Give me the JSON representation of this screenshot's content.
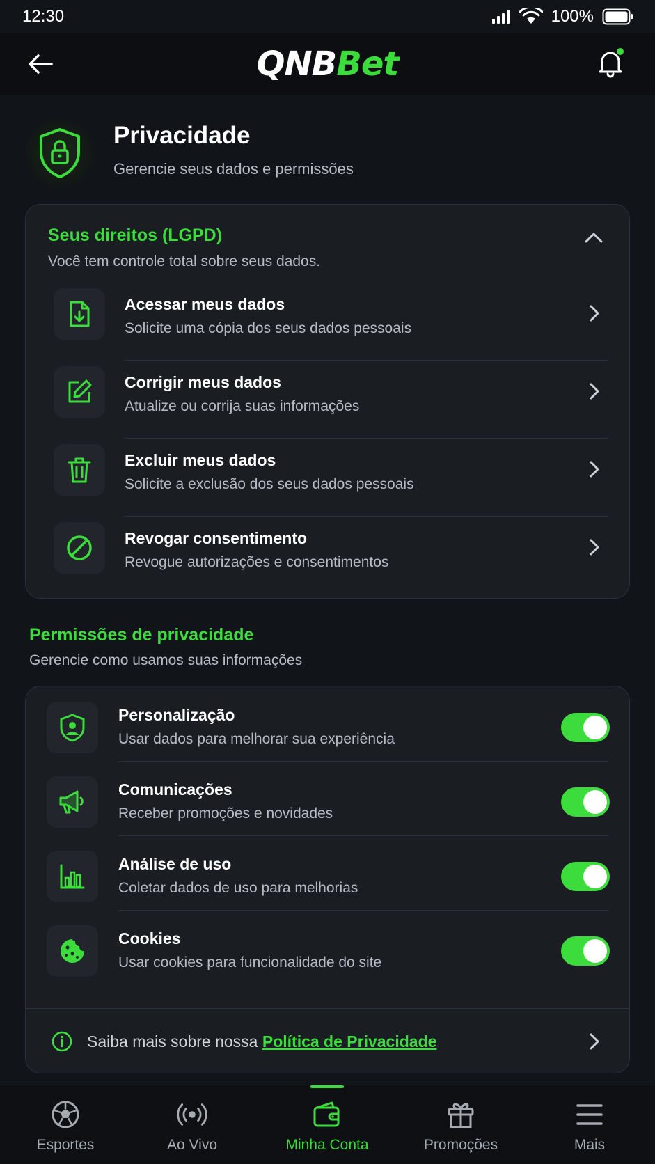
{
  "status_bar": {
    "time": "12:30",
    "battery": "100%"
  },
  "header": {
    "logo_left": "QNB",
    "logo_right": "Bet"
  },
  "page": {
    "title": "Privacidade",
    "subtitle": "Gerencie seus dados e permissões"
  },
  "rights": {
    "title": "Seus direitos (LGPD)",
    "subtitle": "Você tem controle total sobre seus dados.",
    "items": [
      {
        "title": "Acessar meus dados",
        "subtitle": "Solicite uma cópia dos seus dados pessoais",
        "icon": "file-download-icon"
      },
      {
        "title": "Corrigir meus dados",
        "subtitle": "Atualize ou corrija suas informações",
        "icon": "edit-icon"
      },
      {
        "title": "Excluir meus dados",
        "subtitle": "Solicite a exclusão dos seus dados pessoais",
        "icon": "trash-icon"
      },
      {
        "title": "Revogar consentimento",
        "subtitle": "Revogue autorizações e consentimentos",
        "icon": "block-icon"
      }
    ]
  },
  "permissions": {
    "title": "Permissões de privacidade",
    "subtitle": "Gerencie como usamos suas informações",
    "items": [
      {
        "title": "Personalização",
        "subtitle": "Usar dados para melhorar sua experiência",
        "enabled": true,
        "icon": "user-shield-icon"
      },
      {
        "title": "Comunicações",
        "subtitle": "Receber promoções e novidades",
        "enabled": true,
        "icon": "megaphone-icon"
      },
      {
        "title": "Análise de uso",
        "subtitle": "Coletar dados de uso para melhorias",
        "enabled": true,
        "icon": "bar-chart-icon"
      },
      {
        "title": "Cookies",
        "subtitle": "Usar cookies para funcionalidade do site",
        "enabled": true,
        "icon": "cookie-icon"
      }
    ],
    "policy_prefix": "Saiba mais sobre nossa ",
    "policy_link": "Política de Privacidade"
  },
  "bottom_nav": [
    {
      "label": "Esportes",
      "icon": "soccer-ball-icon",
      "active": false
    },
    {
      "label": "Ao Vivo",
      "icon": "live-broadcast-icon",
      "active": false
    },
    {
      "label": "Minha Conta",
      "icon": "wallet-icon",
      "active": true
    },
    {
      "label": "Promoções",
      "icon": "gift-icon",
      "active": false
    },
    {
      "label": "Mais",
      "icon": "menu-icon",
      "active": false
    }
  ],
  "colors": {
    "accent": "#3ddc3d",
    "background": "#111418",
    "card": "#1a1d22"
  }
}
